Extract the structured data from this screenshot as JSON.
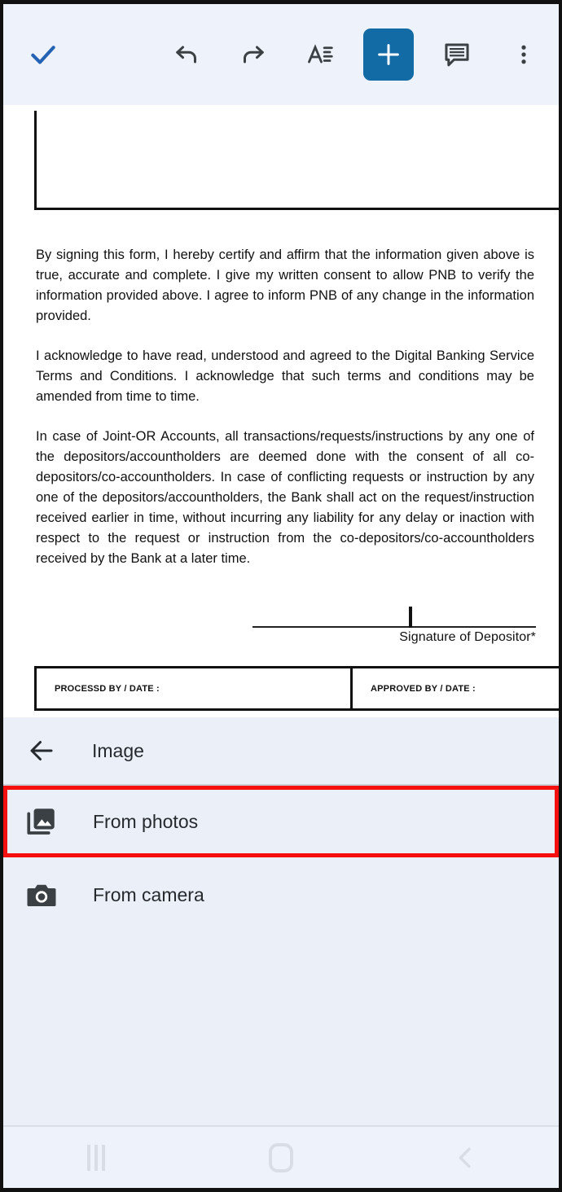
{
  "toolbar": {
    "done_label": "check-icon",
    "undo_label": "undo-icon",
    "redo_label": "redo-icon",
    "format_label": "text-format-icon",
    "insert_label": "+",
    "comment_label": "comment-icon",
    "overflow_label": "more-options-icon",
    "accent_color": "#136ba6",
    "check_color": "#2463b4",
    "bar_background": "#eef2fb"
  },
  "document": {
    "paragraphs": [
      "By signing this form, I hereby certify and affirm that the information given above is true, accurate and complete. I give my written  consent to allow PNB to verify the information provided above. I agree to inform PNB of any change in the information provided.",
      "I acknowledge to have read, understood and agreed to the Digital Banking Service Terms and Conditions. I acknowledge that such  terms and conditions may be amended from time to time.",
      "In case of Joint-OR Accounts, all transactions/requests/instructions by any one of the depositors/accountholders are deemed done  with the consent of all co-depositors/co-accountholders. In case of conflicting requests or instruction by any one of the  depositors/accountholders, the Bank shall act on the request/instruction received earlier in time, without incurring any liability for  any delay or inaction with respect to the request or instruction from  the co-depositors/co-accountholders received by the Bank at a  later time."
    ],
    "signature_label": "Signature of Depositor*",
    "processed_by_label": "PROCESSD BY / DATE :",
    "approved_by_label": "APPROVED BY / DATE :"
  },
  "sheet": {
    "title": "Image",
    "back_label": "back-arrow-icon",
    "background": "#eaeff8",
    "highlight_color": "#f50f0f",
    "items": [
      {
        "label": "From photos",
        "icon": "photos-icon",
        "highlighted": true
      },
      {
        "label": "From camera",
        "icon": "camera-icon",
        "highlighted": false
      }
    ]
  },
  "navbar": {
    "recents_label": "recents-icon",
    "home_label": "home-icon",
    "back_label": "back-icon"
  }
}
